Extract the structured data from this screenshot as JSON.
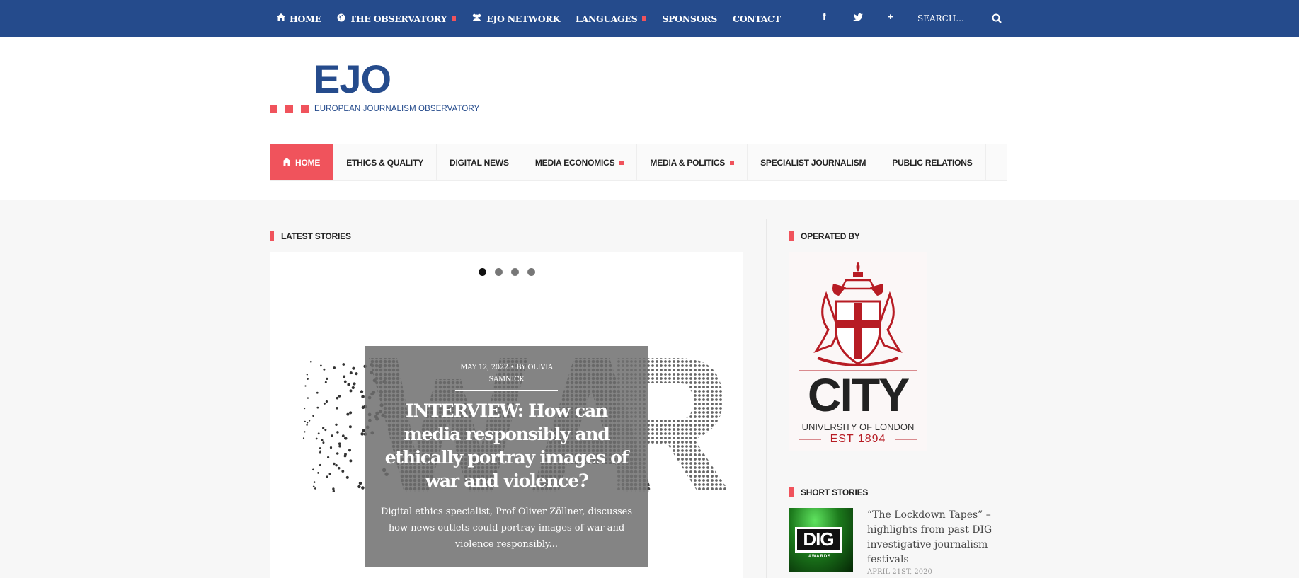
{
  "topnav": {
    "items": [
      {
        "label": "HOME",
        "icon": "home-icon",
        "submenu": false
      },
      {
        "label": "THE OBSERVATORY",
        "icon": "globe-icon",
        "submenu": true
      },
      {
        "label": "EJO NETWORK",
        "icon": "users-icon",
        "submenu": false
      },
      {
        "label": "LANGUAGES",
        "icon": "",
        "submenu": true
      },
      {
        "label": "SPONSORS",
        "icon": "",
        "submenu": false
      },
      {
        "label": "CONTACT",
        "icon": "",
        "submenu": false
      }
    ],
    "social": {
      "facebook": "f",
      "plus": "+"
    },
    "search_placeholder": "SEARCH..."
  },
  "logo": {
    "name": "EJO",
    "subtitle": "EUROPEAN JOURNALISM OBSERVATORY"
  },
  "mainnav": {
    "items": [
      {
        "label": "HOME",
        "active": true,
        "submenu": false
      },
      {
        "label": "ETHICS & QUALITY",
        "active": false,
        "submenu": false
      },
      {
        "label": "DIGITAL NEWS",
        "active": false,
        "submenu": false
      },
      {
        "label": "MEDIA ECONOMICS",
        "active": false,
        "submenu": true
      },
      {
        "label": "MEDIA & POLITICS",
        "active": false,
        "submenu": true
      },
      {
        "label": "SPECIALIST JOURNALISM",
        "active": false,
        "submenu": false
      },
      {
        "label": "PUBLIC RELATIONS",
        "active": false,
        "submenu": false
      }
    ]
  },
  "latest": {
    "heading": "LATEST STORIES",
    "slides": 4,
    "active_slide": 1,
    "featured": {
      "meta": "MAY 12, 2022 • BY OLIVIA SAMNICK",
      "title": "INTERVIEW: How can media responsibly and ethically portray images of war and violence?",
      "excerpt": "Digital ethics specialist, Prof Oliver Zöllner, discusses how news outlets could portray images of war and violence responsibly..."
    }
  },
  "sidebar": {
    "operated_heading": "OPERATED BY",
    "operator": {
      "name": "CITY",
      "line1": "UNIVERSITY OF LONDON",
      "line2": "EST 1894"
    },
    "short_heading": "SHORT STORIES",
    "short_story": {
      "thumb_label": "DIG",
      "thumb_sub": "AWARDS",
      "title": "“The Lockdown Tapes” – highlights from past DIG investigative journalism festivals",
      "date": "APRIL 21ST, 2020"
    }
  },
  "colors": {
    "topbar": "#254b8c",
    "accent": "#f0535c",
    "crest_red": "#b71c24"
  }
}
